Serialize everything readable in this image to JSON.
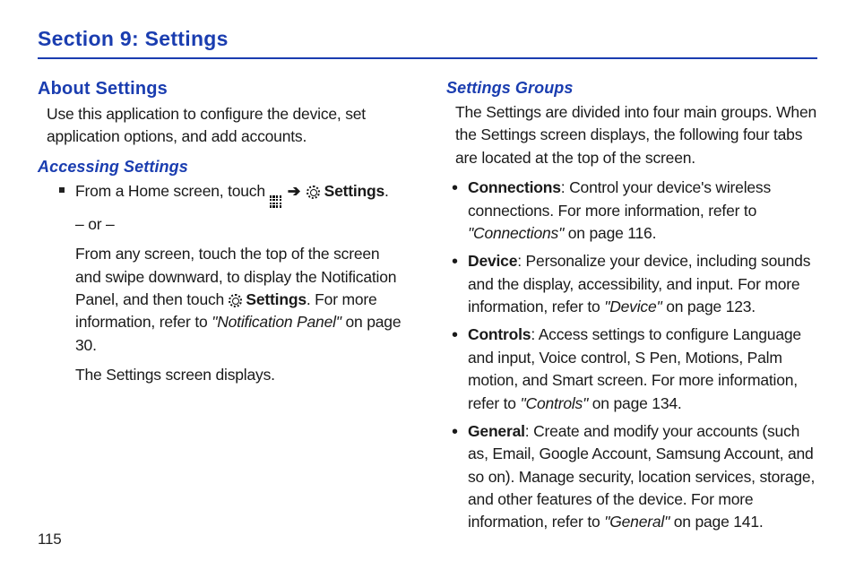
{
  "section_title": "Section 9: Settings",
  "page_number": "115",
  "left": {
    "heading": "About Settings",
    "intro": "Use this application to configure the device, set application options, and add accounts.",
    "sub_heading": "Accessing Settings",
    "bullet_prefix": "From a Home screen, touch ",
    "bullet_settings_label": "Settings",
    "or_text": "– or –",
    "swipe_text_1": "From any screen, touch the top of the screen and swipe downward, to display the Notification Panel, and then touch ",
    "swipe_settings_label": "Settings",
    "swipe_text_2": ". For more information, refer to ",
    "swipe_ref": "\"Notification Panel\"",
    "swipe_page": " on page 30.",
    "final": "The Settings screen displays."
  },
  "right": {
    "sub_heading": "Settings Groups",
    "intro": "The Settings are divided into four main groups. When the Settings screen displays, the following four tabs are located at the top of the screen.",
    "items": [
      {
        "title": "Connections",
        "body": ": Control your device's wireless connections. For more information, refer to ",
        "ref": "\"Connections\"",
        "page": " on page 116."
      },
      {
        "title": "Device",
        "body": ": Personalize your device, including sounds and the display, accessibility, and input. For more information, refer to ",
        "ref": "\"Device\"",
        "page": " on page 123."
      },
      {
        "title": "Controls",
        "body": ": Access settings to configure Language and input, Voice control, S Pen, Motions, Palm motion, and Smart screen. For more information, refer to ",
        "ref": "\"Controls\"",
        "page": " on page 134."
      },
      {
        "title": "General",
        "body": ": Create and modify your accounts (such as, Email, Google Account, Samsung Account, and so on). Manage security, location services, storage, and other features of the device. For more information, refer to ",
        "ref": "\"General\"",
        "page": " on page 141."
      }
    ]
  }
}
